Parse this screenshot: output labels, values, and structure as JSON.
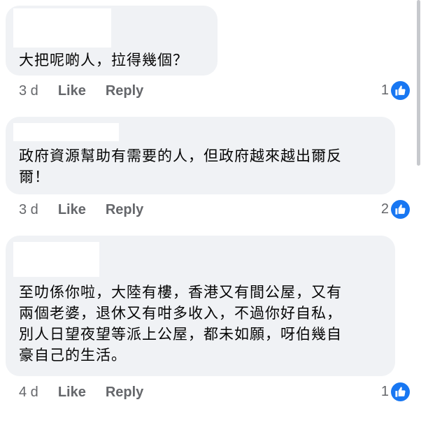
{
  "comments": [
    {
      "lines": [
        "大把呢啲人，拉得幾個？"
      ],
      "time": "3 d",
      "like_label": "Like",
      "reply_label": "Reply",
      "reaction_count": "1"
    },
    {
      "lines": [
        "政府資源幫助有需要的人，但政府越來越出爾反",
        "爾！"
      ],
      "time": "3 d",
      "like_label": "Like",
      "reply_label": "Reply",
      "reaction_count": "2"
    },
    {
      "lines": [
        "至叻係你啦，大陸有樓，香港又有間公屋，又有",
        "兩個老婆，退休又有咁多收入，不過你好自私，",
        "別人日望夜望等派上公屋，都未如願，呀伯幾自",
        "豪自己的生活。"
      ],
      "time": "4 d",
      "like_label": "Like",
      "reply_label": "Reply",
      "reaction_count": "1"
    }
  ],
  "colors": {
    "bubble": "#f0f2f5",
    "text": "#050505",
    "meta": "#65676b",
    "like_blue": "#1877f2"
  },
  "icons": {
    "reaction": "thumbs-up-icon"
  }
}
